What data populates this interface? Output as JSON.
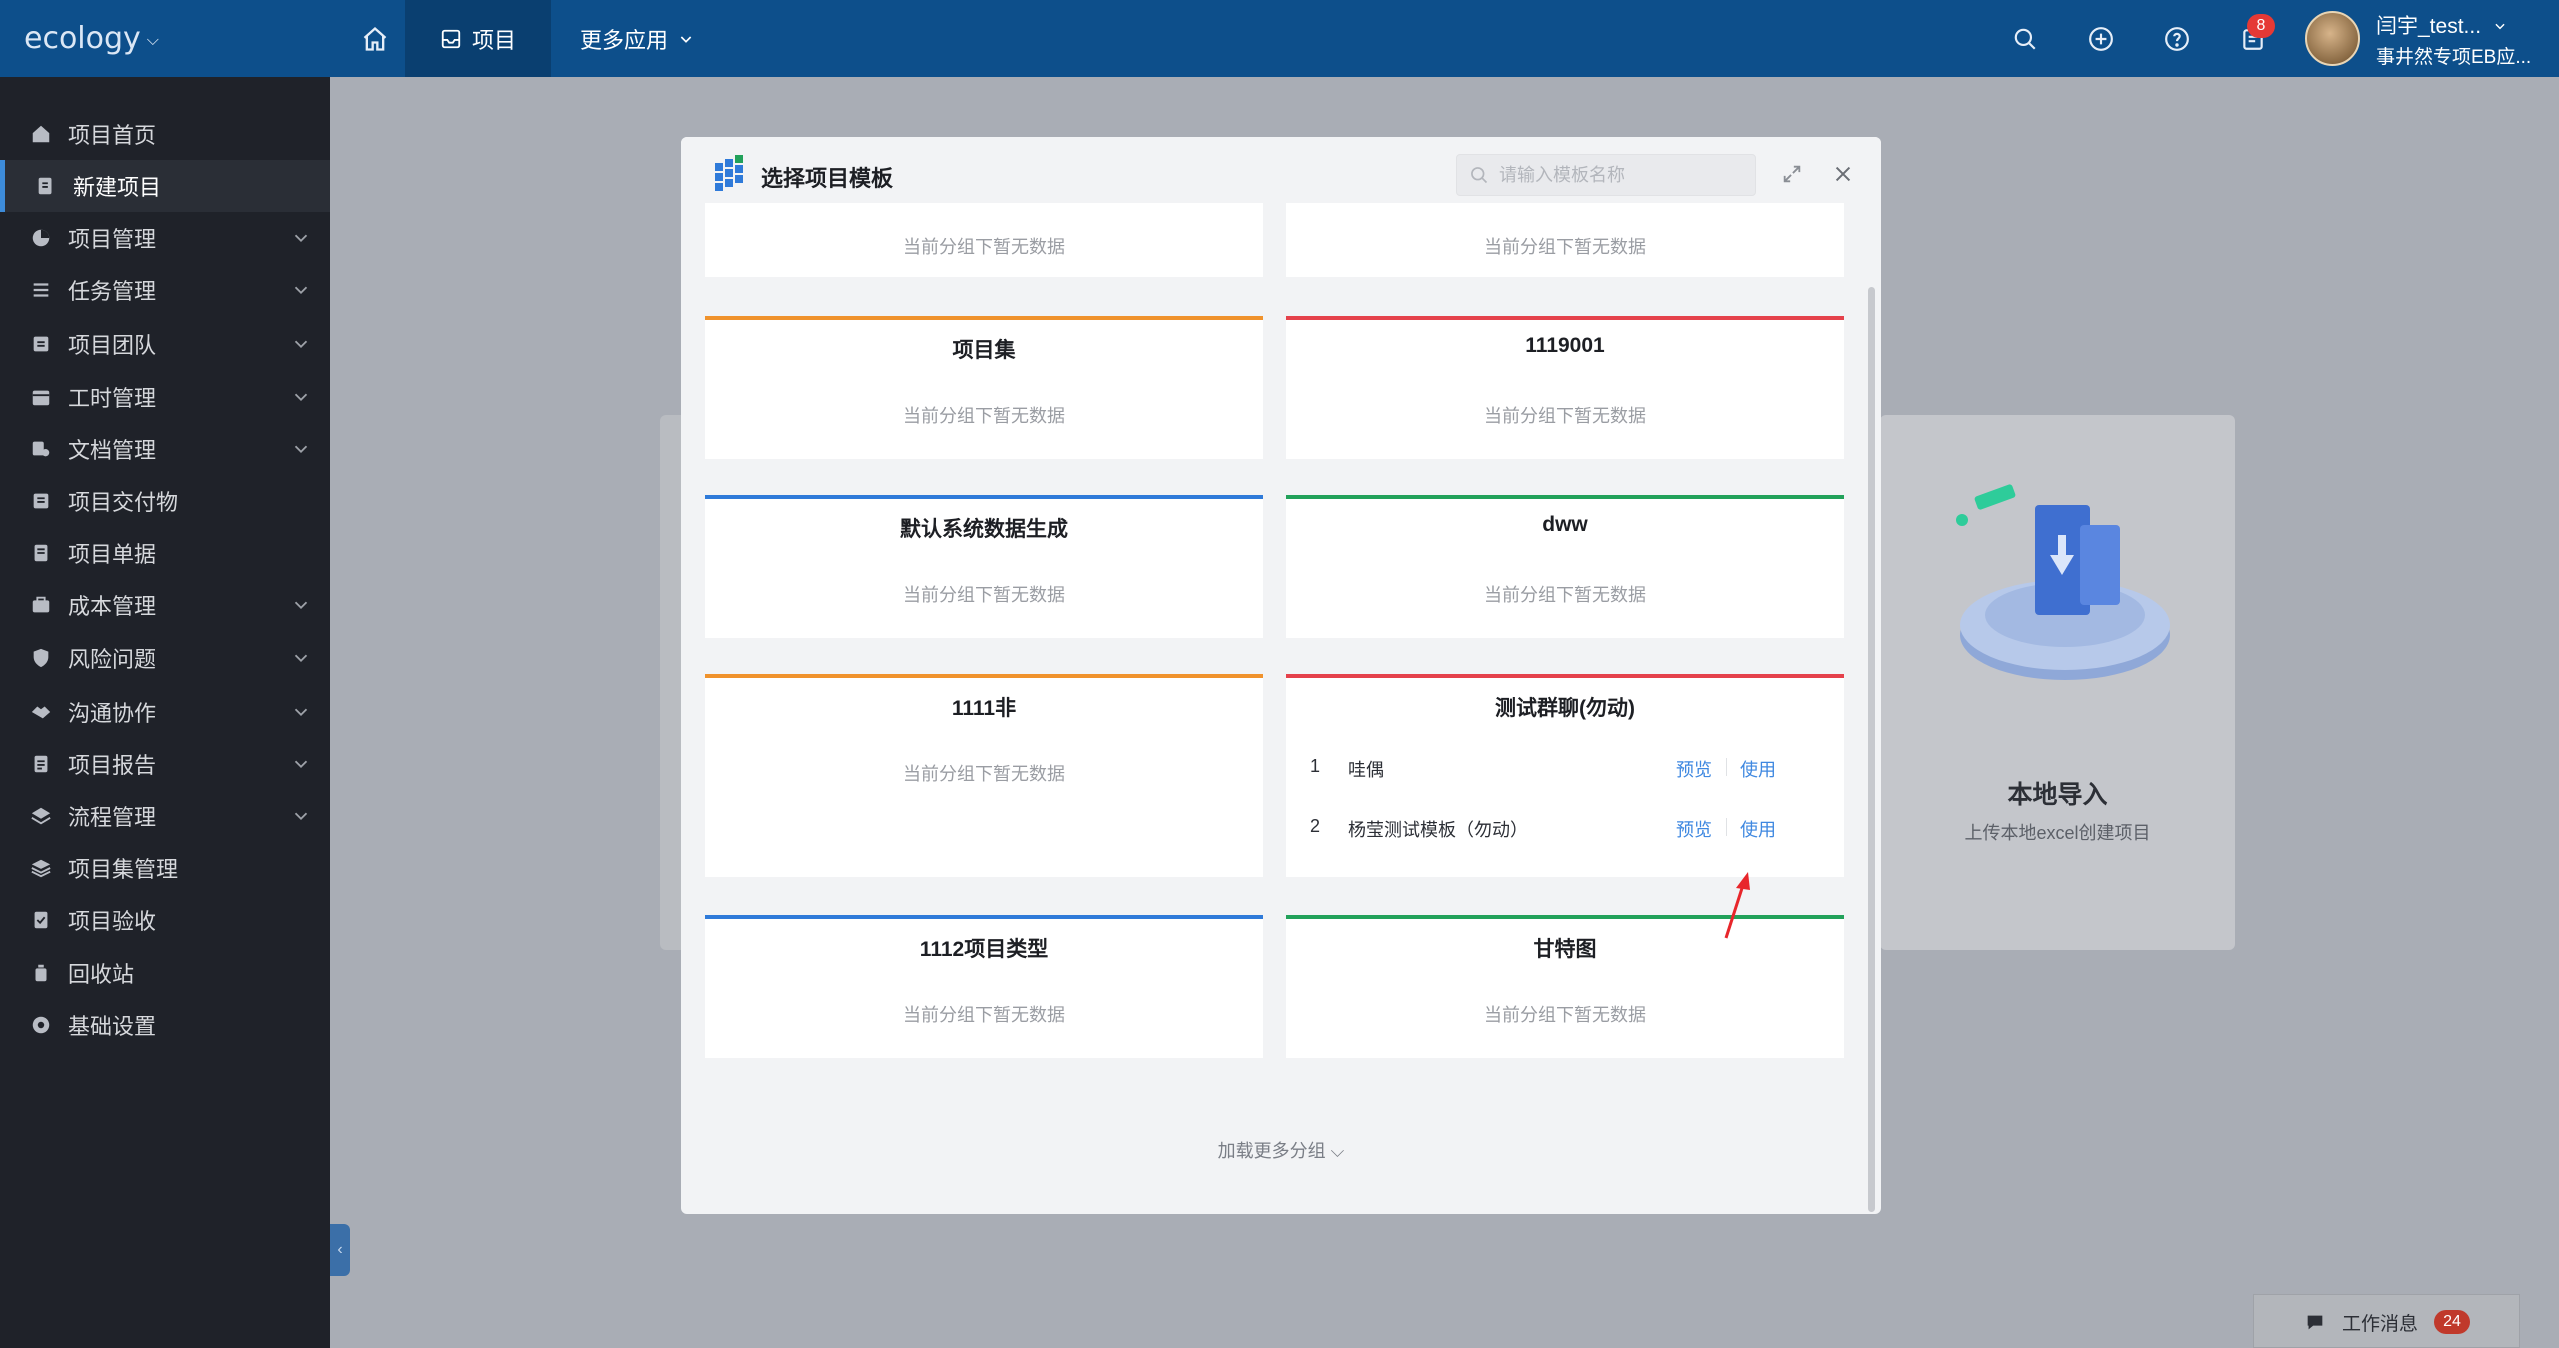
{
  "topbar": {
    "brand": "ecology",
    "home_icon": "home-icon",
    "active_nav_label": "项目",
    "more_apps_label": "更多应用",
    "notification_count": "8",
    "user_name": "闫宇_test...",
    "user_org": "事井然专项EB应...",
    "colors": {
      "bar": "#0d4f8b",
      "active": "#0a3f70"
    }
  },
  "sidebar": {
    "items": [
      {
        "label": "项目首页",
        "icon": "home-icon",
        "has_arrow": false,
        "active": false
      },
      {
        "label": "新建项目",
        "icon": "new-doc-icon",
        "has_arrow": false,
        "active": true
      },
      {
        "label": "项目管理",
        "icon": "pie-icon",
        "has_arrow": true,
        "active": false
      },
      {
        "label": "任务管理",
        "icon": "list-icon",
        "has_arrow": true,
        "active": false
      },
      {
        "label": "项目团队",
        "icon": "team-icon",
        "has_arrow": true,
        "active": false
      },
      {
        "label": "工时管理",
        "icon": "calendar-icon",
        "has_arrow": true,
        "active": false
      },
      {
        "label": "文档管理",
        "icon": "docs-icon",
        "has_arrow": true,
        "active": false
      },
      {
        "label": "项目交付物",
        "icon": "deliverable-icon",
        "has_arrow": false,
        "active": false
      },
      {
        "label": "项目单据",
        "icon": "receipt-icon",
        "has_arrow": false,
        "active": false
      },
      {
        "label": "成本管理",
        "icon": "briefcase-icon",
        "has_arrow": true,
        "active": false
      },
      {
        "label": "风险问题",
        "icon": "shield-icon",
        "has_arrow": true,
        "active": false
      },
      {
        "label": "沟通协作",
        "icon": "handshake-icon",
        "has_arrow": true,
        "active": false
      },
      {
        "label": "项目报告",
        "icon": "report-icon",
        "has_arrow": true,
        "active": false
      },
      {
        "label": "流程管理",
        "icon": "layers-icon",
        "has_arrow": true,
        "active": false
      },
      {
        "label": "项目集管理",
        "icon": "stack-icon",
        "has_arrow": false,
        "active": false
      },
      {
        "label": "项目验收",
        "icon": "check-doc-icon",
        "has_arrow": false,
        "active": false
      },
      {
        "label": "回收站",
        "icon": "trash-icon",
        "has_arrow": false,
        "active": false
      },
      {
        "label": "基础设置",
        "icon": "gear-icon",
        "has_arrow": false,
        "active": false
      }
    ]
  },
  "background": {
    "import_title": "本地导入",
    "import_sub": "上传本地excel创建项目"
  },
  "modal": {
    "title": "选择项目模板",
    "search_placeholder": "请输入模板名称",
    "empty_text": "当前分组下暂无数据",
    "load_more": "加载更多分组",
    "cards": [
      {
        "title": "",
        "color": "",
        "empty": true
      },
      {
        "title": "",
        "color": "",
        "empty": true
      },
      {
        "title": "项目集",
        "color": "#f0922c",
        "empty": true
      },
      {
        "title": "1119001",
        "color": "#e5414b",
        "empty": true
      },
      {
        "title": "默认系统数据生成",
        "color": "#2f7ad9",
        "empty": true
      },
      {
        "title": "dww",
        "color": "#22a15a",
        "empty": true
      },
      {
        "title": "1111非",
        "color": "#f0922c",
        "empty": true
      },
      {
        "title": "测试群聊(勿动)",
        "color": "#e5414b",
        "empty": false,
        "rows": [
          {
            "index": "1",
            "name": "哇偶",
            "preview": "预览",
            "use": "使用"
          },
          {
            "index": "2",
            "name": "杨莹测试模板（勿动）",
            "preview": "预览",
            "use": "使用"
          }
        ]
      },
      {
        "title": "1112项目类型",
        "color": "#2f7ad9",
        "empty": true
      },
      {
        "title": "甘特图",
        "color": "#22a15a",
        "empty": true
      }
    ]
  },
  "work_messages": {
    "label": "工作消息",
    "count": "24"
  }
}
